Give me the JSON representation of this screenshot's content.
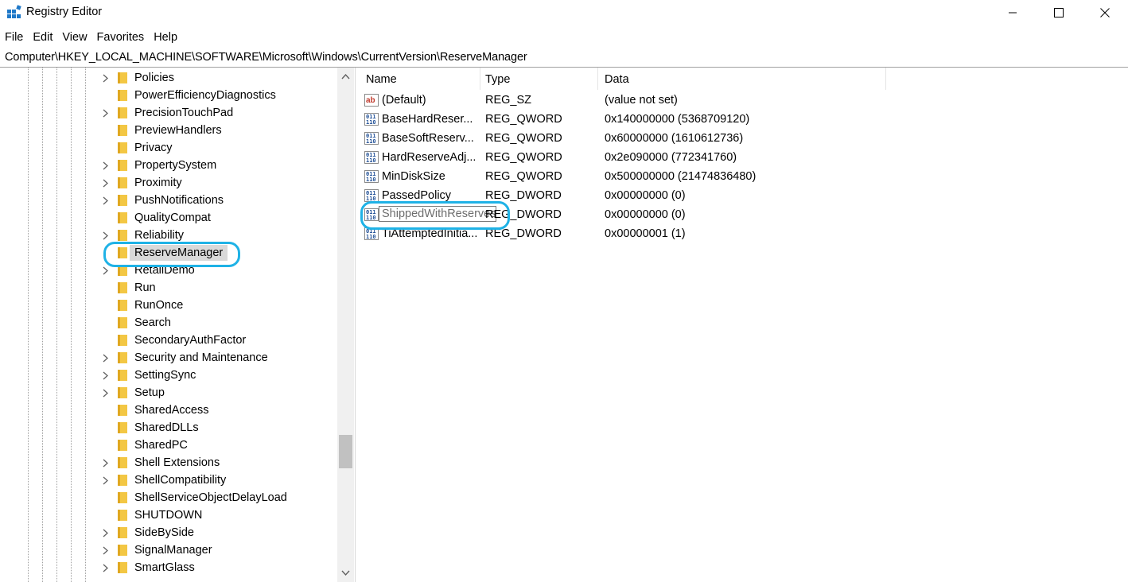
{
  "window": {
    "title": "Registry Editor",
    "app_icon": "registry-editor-icon",
    "controls": [
      "minimize-icon",
      "maximize-icon",
      "close-icon"
    ]
  },
  "menu": {
    "items": [
      "File",
      "Edit",
      "View",
      "Favorites",
      "Help"
    ]
  },
  "address": {
    "path": "Computer\\HKEY_LOCAL_MACHINE\\SOFTWARE\\Microsoft\\Windows\\CurrentVersion\\ReserveManager"
  },
  "tree": {
    "items": [
      {
        "label": "Policies",
        "expandable": true
      },
      {
        "label": "PowerEfficiencyDiagnostics",
        "expandable": false
      },
      {
        "label": "PrecisionTouchPad",
        "expandable": true
      },
      {
        "label": "PreviewHandlers",
        "expandable": false
      },
      {
        "label": "Privacy",
        "expandable": false
      },
      {
        "label": "PropertySystem",
        "expandable": true
      },
      {
        "label": "Proximity",
        "expandable": true
      },
      {
        "label": "PushNotifications",
        "expandable": true
      },
      {
        "label": "QualityCompat",
        "expandable": false
      },
      {
        "label": "Reliability",
        "expandable": true
      },
      {
        "label": "ReserveManager",
        "expandable": false,
        "selected": true
      },
      {
        "label": "RetailDemo",
        "expandable": true
      },
      {
        "label": "Run",
        "expandable": false
      },
      {
        "label": "RunOnce",
        "expandable": false
      },
      {
        "label": "Search",
        "expandable": false
      },
      {
        "label": "SecondaryAuthFactor",
        "expandable": false
      },
      {
        "label": "Security and Maintenance",
        "expandable": true
      },
      {
        "label": "SettingSync",
        "expandable": true
      },
      {
        "label": "Setup",
        "expandable": true
      },
      {
        "label": "SharedAccess",
        "expandable": false
      },
      {
        "label": "SharedDLLs",
        "expandable": false
      },
      {
        "label": "SharedPC",
        "expandable": false
      },
      {
        "label": "Shell Extensions",
        "expandable": true
      },
      {
        "label": "ShellCompatibility",
        "expandable": true
      },
      {
        "label": "ShellServiceObjectDelayLoad",
        "expandable": false
      },
      {
        "label": "SHUTDOWN",
        "expandable": false
      },
      {
        "label": "SideBySide",
        "expandable": true
      },
      {
        "label": "SignalManager",
        "expandable": true
      },
      {
        "label": "SmartGlass",
        "expandable": true
      }
    ]
  },
  "list": {
    "columns": [
      "Name",
      "Type",
      "Data"
    ],
    "rows": [
      {
        "icon": "string-value-icon",
        "name": "(Default)",
        "type": "REG_SZ",
        "data": "(value not set)"
      },
      {
        "icon": "binary-value-icon",
        "name": "BaseHardReserveSize",
        "type": "REG_QWORD",
        "data": "0x140000000 (5368709120)"
      },
      {
        "icon": "binary-value-icon",
        "name": "BaseSoftReserveSize",
        "type": "REG_QWORD",
        "data": "0x60000000 (1610612736)"
      },
      {
        "icon": "binary-value-icon",
        "name": "HardReserveAdjustment",
        "type": "REG_QWORD",
        "data": "0x2e090000 (772341760)"
      },
      {
        "icon": "binary-value-icon",
        "name": "MinDiskSize",
        "type": "REG_QWORD",
        "data": "0x500000000 (21474836480)"
      },
      {
        "icon": "binary-value-icon",
        "name": "PassedPolicy",
        "type": "REG_DWORD",
        "data": "0x00000000 (0)"
      },
      {
        "icon": "binary-value-icon",
        "name": "ShippedWithReserves",
        "type": "REG_DWORD",
        "data": "0x00000000 (0)",
        "editing": true,
        "edit_value": "ShippedWithReserves"
      },
      {
        "icon": "binary-value-icon",
        "name": "TiAttemptedInitialization",
        "type": "REG_DWORD",
        "data": "0x00000001 (1)"
      }
    ]
  },
  "colors": {
    "highlight_ring": "#1fb2e6",
    "selection": "#d9d9d9",
    "folder": "#f3c744"
  }
}
